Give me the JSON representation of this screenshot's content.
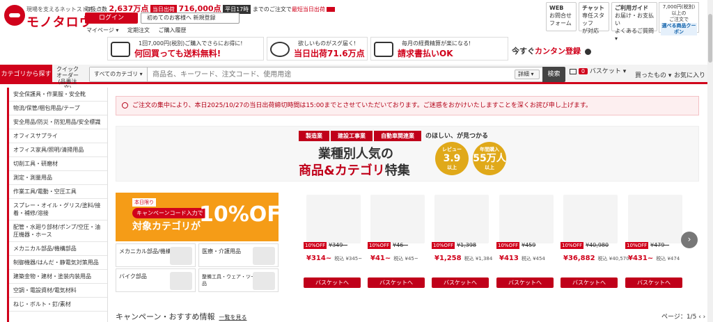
{
  "header": {
    "tagline": "現場を支えるネットストア",
    "brand": "モノタロウ",
    "stats_prefix": "取扱点数",
    "items_count": "2,637万点",
    "sameday_badge": "当日出荷",
    "sameday_count": "716,000点",
    "weekday_badge": "平日17時",
    "order_deadline": "までのご注文で",
    "fastest_ship": "最短当日出荷",
    "login": "ログイン",
    "register": "初めてのお客様へ 新規登録",
    "nav": [
      "マイページ ▾",
      "定期注文",
      "ご購入履歴"
    ]
  },
  "top_right": [
    {
      "title": "WEB",
      "lines": [
        "お問合せ",
        "フォーム"
      ]
    },
    {
      "title": "チャット",
      "lines": [
        "専任スタッフ",
        "が対応"
      ]
    },
    {
      "title": "ご利用ガイド",
      "lines": [
        "お届け・お支払い",
        "よくあるご質問 ▾"
      ]
    }
  ],
  "coupon": {
    "line1": "7,000円(税別)以上の",
    "line2": "ご注文で",
    "line3": "選べる商品クーポン"
  },
  "promos": [
    {
      "small": "1回7,000円(税別)ご購入でさらにお得に!",
      "big": "何回買っても送料無料!"
    },
    {
      "small": "欲しいものがスグ届く!",
      "big": "当日出荷71.6万点"
    },
    {
      "small": "毎月の経費精算が楽になる!",
      "big": "請求書払いOK"
    }
  ],
  "register_now": {
    "prefix": "今すぐ",
    "emph": "カンタン登録"
  },
  "searchbar": {
    "category_button": "カテゴリから探す",
    "quick_order": "クイック オーダー (品番注文)",
    "category_select": "すべてのカテゴリ",
    "placeholder": "商品名、キーワード、注文コード、使用用途",
    "detail": "詳細",
    "search": "検索",
    "cart_count": "0",
    "cart": "バスケット",
    "bought": "買ったもの",
    "favorites": "お気に入り"
  },
  "sidebar": [
    "安全保護具・作業服・安全靴",
    "物流/保管/梱包用品/テープ",
    "安全用品/防災・防犯用品/安全標識",
    "オフィスサプライ",
    "オフィス家具/照明/清掃用品",
    "切削工具・研磨材",
    "測定・測量用品",
    "作業工具/電動・空圧工具",
    "スプレー・オイル・グリス/塗料/接着・補修/溶接",
    "配管・水廻り部材/ポンプ/空圧・油圧機器・ホース",
    "メカニカル部品/機構部品",
    "制御機器/はんだ・静電気対策用品",
    "建築金物・建材・塗装内装用品",
    "空調・電設資材/電気材料",
    "ねじ・ボルト・釘/素材"
  ],
  "notice": "ご注文の集中により、本日2025/10/27の当日出荷締切時間は15:00までとさせていただいております。ご迷惑をおかけいたしますことを深くお詫び申し上げます。",
  "banner": {
    "chips": [
      "製造業",
      "建設工事業",
      "自動車関連業"
    ],
    "chips_after": "のほしい、が見つかる",
    "title1": "業種別人気の",
    "title2_red": "商品&カテゴリ",
    "title2_rest": "特集",
    "medal1": {
      "label": "レビュー",
      "value": "3.9",
      "unit": "以上"
    },
    "medal2": {
      "label": "年間購入",
      "value": "55万人",
      "unit": "以上"
    }
  },
  "campaign": {
    "tag": "本日限り",
    "code": "キャンペーンコード入力で",
    "text": "対象カテゴリが",
    "pct": "10%OFF"
  },
  "categories": [
    "メカニカル部品/機構部品",
    "医療・介護用品",
    "バイク部品",
    "整備工具・ウェア・ツーリング用品"
  ],
  "products": [
    {
      "off": "10%OFF",
      "orig": "¥349~",
      "price": "¥314~",
      "tax": "税込 ¥345~"
    },
    {
      "off": "10%OFF",
      "orig": "¥46~",
      "price": "¥41~",
      "tax": "税込 ¥45~"
    },
    {
      "off": "10%OFF",
      "orig": "¥1,398",
      "price": "¥1,258",
      "tax": "税込 ¥1,384"
    },
    {
      "off": "10%OFF",
      "orig": "¥459",
      "price": "¥413",
      "tax": "税込 ¥454"
    },
    {
      "off": "10%OFF",
      "orig": "¥40,980",
      "price": "¥36,882",
      "tax": "税込 ¥40,570"
    },
    {
      "off": "10%OFF",
      "orig": "¥479~",
      "price": "¥431~",
      "tax": "税込 ¥474"
    }
  ],
  "cart_button": "バスケットへ",
  "section": {
    "title": "キャンペーン・おすすめ情報",
    "link": "一覧を見る",
    "page": "ページ：1/5"
  }
}
